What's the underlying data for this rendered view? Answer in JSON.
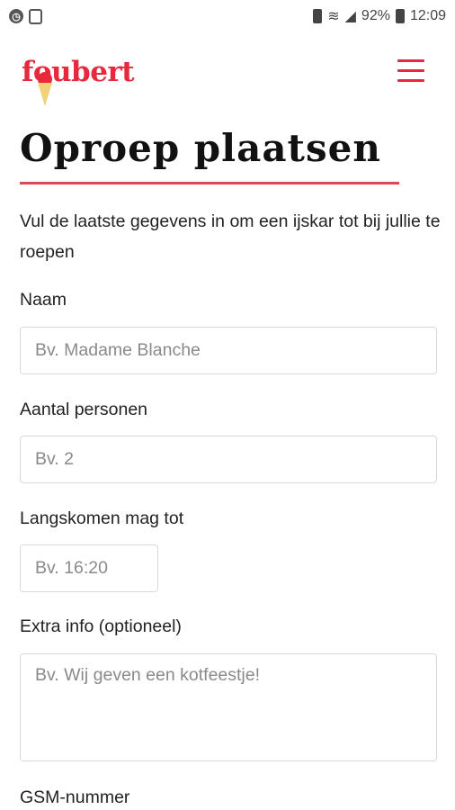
{
  "status_bar": {
    "battery": "92%",
    "time": "12:09"
  },
  "header": {
    "logo_text": "foubert",
    "menu_icon": "hamburger-icon",
    "brand_color": "#e8283c"
  },
  "page": {
    "title": "Oproep plaatsen",
    "intro": "Vul de laatste gegevens in om een ijskar tot bij jullie te roepen"
  },
  "form": {
    "name": {
      "label": "Naam",
      "placeholder": "Bv. Madame Blanche"
    },
    "persons": {
      "label": "Aantal personen",
      "placeholder": "Bv. 2"
    },
    "time": {
      "label": "Langskomen mag tot",
      "placeholder": "Bv. 16:20"
    },
    "extra": {
      "label": "Extra info (optioneel)",
      "placeholder": "Bv. Wij geven een kotfeestje!"
    },
    "phone": {
      "label": "GSM-nummer"
    }
  }
}
